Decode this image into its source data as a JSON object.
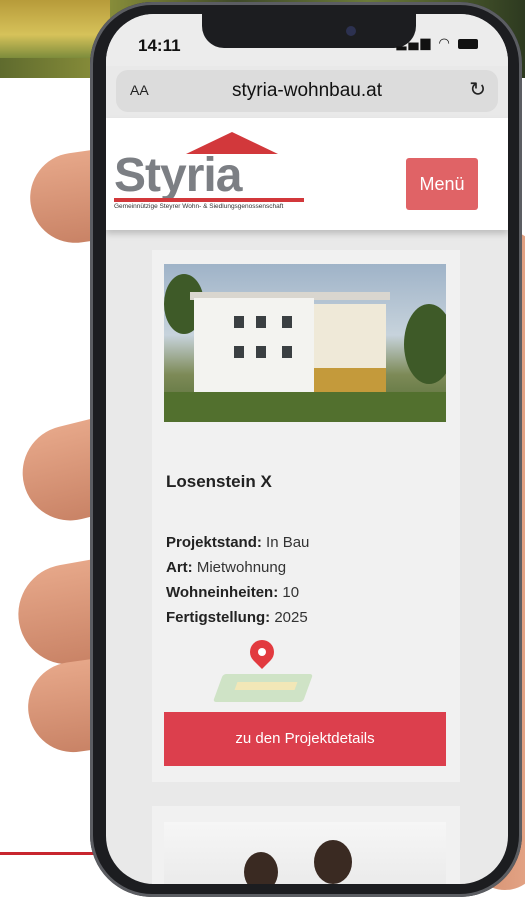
{
  "status_bar": {
    "time": "14:11"
  },
  "browser": {
    "text_size_label": "AA",
    "url": "styria-wohnbau.at",
    "reload_icon": "reload-icon"
  },
  "header": {
    "logo_word": "Styria",
    "logo_tagline": "Gemeinnützige Steyrer Wohn- & Siedlungsgenossenschaft",
    "menu_label": "Menü"
  },
  "project": {
    "title": "Losenstein X",
    "facts": [
      {
        "label": "Projektstand:",
        "value": "In Bau"
      },
      {
        "label": "Art:",
        "value": "Mietwohnung"
      },
      {
        "label": "Wohneinheiten:",
        "value": "10"
      },
      {
        "label": "Fertigstellung:",
        "value": "2025"
      }
    ],
    "cta_label": "zu den Projektdetails"
  },
  "colors": {
    "accent": "#dc3f4d",
    "menu": "#e06366",
    "logo_gray": "#7c7f84"
  }
}
